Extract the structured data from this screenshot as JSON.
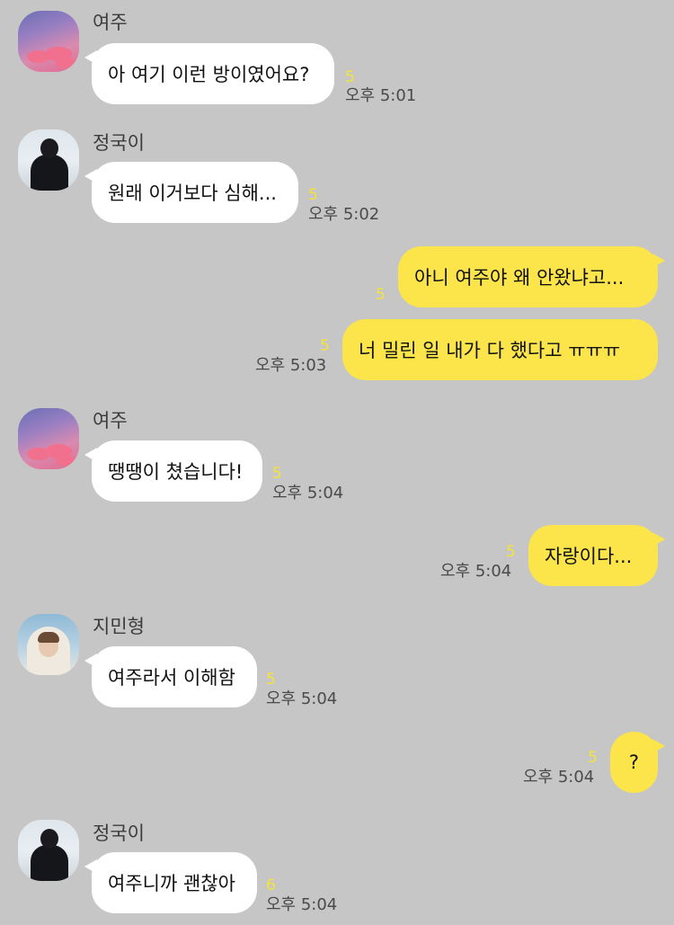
{
  "messages": [
    {
      "sender": "여주",
      "text": "아 여기 이런 방이였어요?",
      "unread": "5",
      "time": "오후 5:01"
    },
    {
      "sender": "정국이",
      "text": "원래 이거보다 심해...",
      "unread": "5",
      "time": "오후 5:02"
    },
    {
      "text": "아니 여주야 왜 안왔냐고...",
      "unread": "5"
    },
    {
      "text": "너 밀린 일 내가 다 했다고 ㅠㅠㅠ",
      "unread": "5",
      "time": "오후 5:03"
    },
    {
      "sender": "여주",
      "text": "땡땡이 쳤습니다!",
      "unread": "5",
      "time": "오후 5:04"
    },
    {
      "text": "자랑이다...",
      "unread": "5",
      "time": "오후 5:04"
    },
    {
      "sender": "지민형",
      "text": "여주라서 이해함",
      "unread": "5",
      "time": "오후 5:04"
    },
    {
      "text": "?",
      "unread": "5",
      "time": "오후 5:04"
    },
    {
      "sender": "정국이",
      "text": "여주니까 괜찮아",
      "unread": "6",
      "time": "오후 5:04"
    }
  ]
}
